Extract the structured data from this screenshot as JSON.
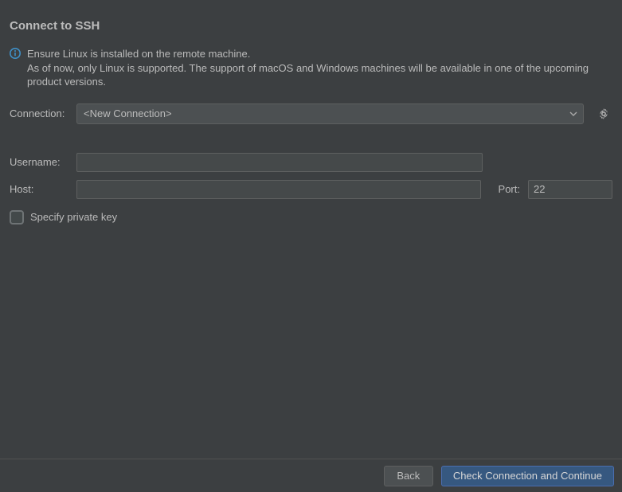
{
  "title": "Connect to SSH",
  "info": {
    "line1": "Ensure Linux is installed on the remote machine.",
    "line2": "As of now, only Linux is supported. The support of macOS and Windows machines will be available in one of the upcoming product versions."
  },
  "labels": {
    "connection": "Connection:",
    "username": "Username:",
    "host": "Host:",
    "port": "Port:",
    "specify_private_key": "Specify private key"
  },
  "connection": {
    "selected": "<New Connection>"
  },
  "fields": {
    "username": "",
    "host": "",
    "port": "22"
  },
  "checkbox": {
    "specify_private_key_checked": false
  },
  "buttons": {
    "back": "Back",
    "continue": "Check Connection and Continue"
  }
}
